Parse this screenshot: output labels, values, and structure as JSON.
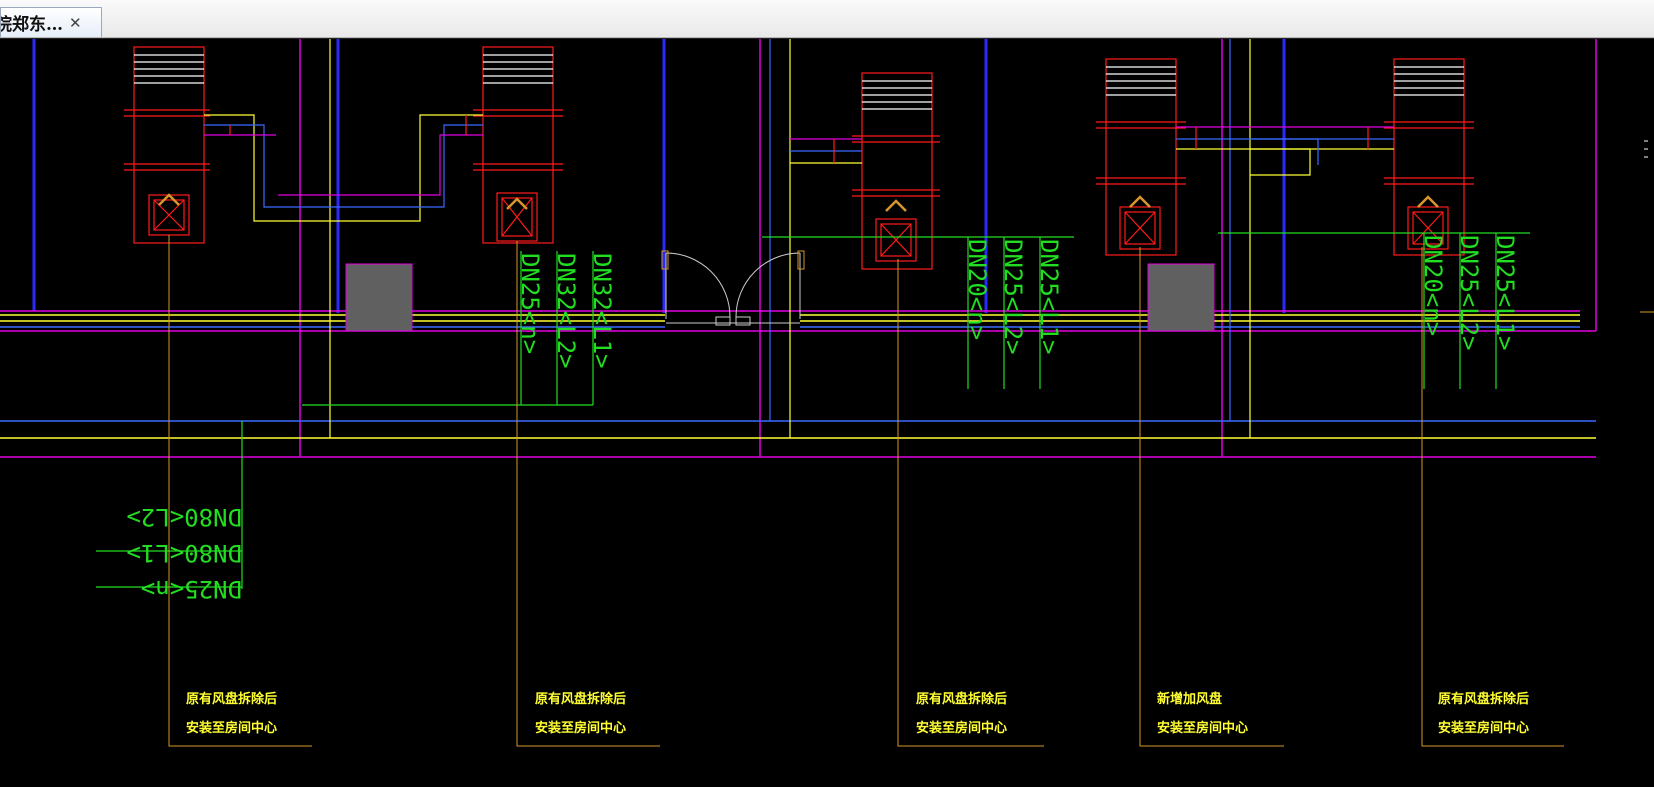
{
  "tab": {
    "title": "院郑东…",
    "close": "✕"
  },
  "colors": {
    "background": "#000000",
    "red": "#ff1a1a",
    "magenta": "#e100e1",
    "yellow": "#ffff33",
    "green": "#22dd22",
    "blue": "#3a6bff",
    "orange": "#d6962a",
    "white": "#ffffff",
    "gray": "#606060"
  },
  "pipe_labels": {
    "unit2": [
      "DN25<n>",
      "DN32<L2>",
      "DN32<L1>"
    ],
    "unit3": [
      "DN20<n>",
      "DN25<L2>",
      "DN25<L1>"
    ],
    "unit5": [
      "DN20<n>",
      "DN25<L2>",
      "DN25<L1>"
    ],
    "main": [
      "DN80<L2>",
      "DN80<L1>",
      "DN25<n>"
    ]
  },
  "notes": [
    {
      "line1": "原有风盘拆除后",
      "line2": "安装至房间中心"
    },
    {
      "line1": "原有风盘拆除后",
      "line2": "安装至房间中心"
    },
    {
      "line1": "原有风盘拆除后",
      "line2": "安装至房间中心"
    },
    {
      "line1": "新增加风盘",
      "line2": "安装至房间中心"
    },
    {
      "line1": "原有风盘拆除后",
      "line2": "安装至房间中心"
    }
  ]
}
